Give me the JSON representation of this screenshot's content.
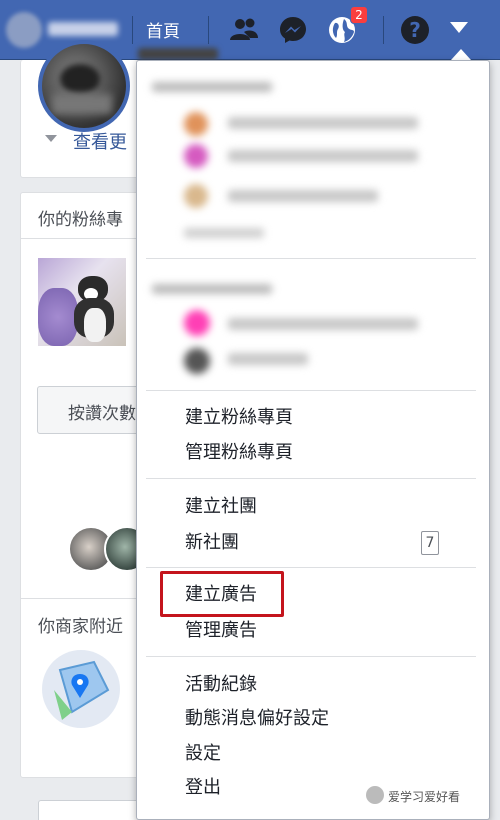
{
  "topbar": {
    "home_label": "首頁",
    "notification_count": "2"
  },
  "left": {
    "see_more_label": "查看更",
    "fan_pages_title": "你的粉絲專",
    "like_button_label": "按讚次數",
    "nearby_title": "你商家附近"
  },
  "menu": {
    "items_pages": [
      "建立粉絲專頁",
      "管理粉絲專頁"
    ],
    "items_groups": [
      "建立社團",
      "新社團"
    ],
    "new_groups_count": "7",
    "items_ads": [
      "建立廣告",
      "管理廣告"
    ],
    "items_settings": [
      "活動紀錄",
      "動態消息偏好設定",
      "設定",
      "登出"
    ]
  },
  "watermark": "爱学习爱好看",
  "colors": {
    "brand": "#4267b2",
    "highlight": "#c4141c",
    "badge": "#fa3e3e"
  }
}
